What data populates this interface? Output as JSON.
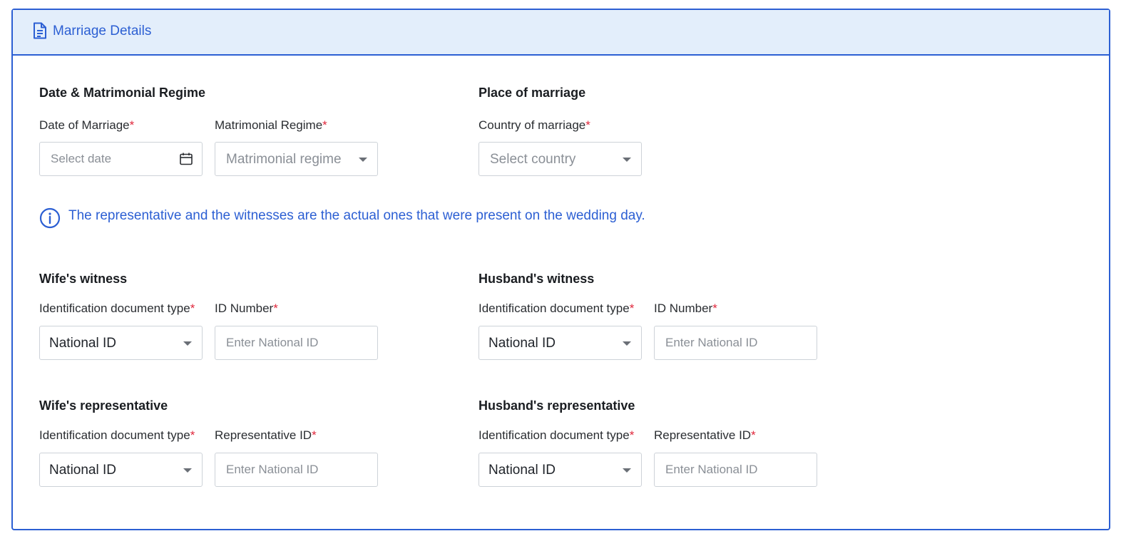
{
  "header": {
    "title": "Marriage Details",
    "icon": "document-icon",
    "accent": "#2c5fd3",
    "background": "#e3eefb"
  },
  "date_regime": {
    "title": "Date & Matrimonial Regime",
    "date_label": "Date of Marriage",
    "date_placeholder": "Select date",
    "regime_label": "Matrimonial Regime",
    "regime_placeholder": "Matrimonial regime"
  },
  "place": {
    "title": "Place of marriage",
    "country_label": "Country of marriage",
    "country_placeholder": "Select country"
  },
  "info": {
    "text": "The representative and the witnesses are the actual ones that were present on the wedding day."
  },
  "wife_witness": {
    "title": "Wife's witness",
    "doc_type_label": "Identification document type",
    "doc_type_value": "National ID",
    "id_label": "ID Number",
    "id_placeholder": "Enter National ID"
  },
  "husband_witness": {
    "title": "Husband's witness",
    "doc_type_label": "Identification document type",
    "doc_type_value": "National ID",
    "id_label": "ID Number",
    "id_placeholder": "Enter National ID"
  },
  "wife_representative": {
    "title": "Wife's representative",
    "doc_type_label": "Identification document type",
    "doc_type_value": "National ID",
    "id_label": "Representative ID",
    "id_placeholder": "Enter National ID"
  },
  "husband_representative": {
    "title": "Husband's representative",
    "doc_type_label": "Identification document type",
    "doc_type_value": "National ID",
    "id_label": "Representative ID",
    "id_placeholder": "Enter National ID"
  },
  "required_marker": "*"
}
